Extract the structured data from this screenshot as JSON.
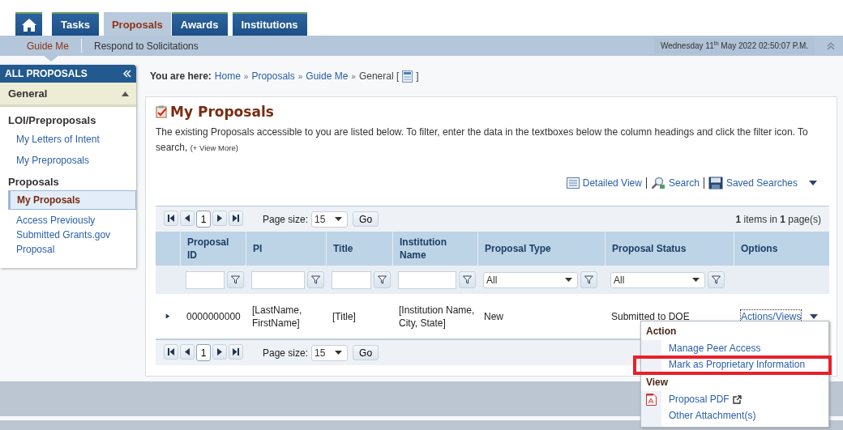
{
  "tabs": [
    {
      "kind": "home",
      "selected": false
    },
    {
      "kind": "text",
      "label": "Tasks",
      "selected": false
    },
    {
      "kind": "text",
      "label": "Proposals",
      "selected": true
    },
    {
      "kind": "text",
      "label": "Awards",
      "selected": false
    },
    {
      "kind": "text",
      "label": "Institutions",
      "selected": false
    }
  ],
  "subnav": [
    {
      "label": "Guide Me",
      "selected": true
    },
    {
      "label": "Respond to Solicitations",
      "selected": false
    }
  ],
  "datetime": "Wednesday 11$^{th}$ May 2022 02:50:07 P.M.",
  "sidebar": {
    "title": "ALL PROPOSALS",
    "sections": [
      {
        "label": "General",
        "expanded": true,
        "groups": [
          {
            "heading": "LOI/Preproposals",
            "items": [
              {
                "label": "My Letters of Intent",
                "selected": false
              },
              {
                "label": "My Preproposals",
                "selected": false
              }
            ]
          },
          {
            "heading": "Proposals",
            "items": [
              {
                "label": "My Proposals",
                "selected": true
              },
              {
                "label": "Access Previously Submitted Grants.gov Proposal",
                "selected": false
              }
            ]
          }
        ]
      }
    ]
  },
  "breadcrumb": {
    "prefix": "You are here:",
    "links": [
      "Home",
      "Proposals",
      "Guide Me"
    ],
    "separator": "»",
    "current": "General [",
    "suffix": "]"
  },
  "panel": {
    "title": "My Proposals",
    "description": "The existing Proposals accessible to you are listed below. To filter, enter the data in the textboxes below the column headings and click the filter icon. To search,",
    "more_link": "(+ View More)",
    "toolbar": [
      {
        "kind": "list",
        "label": "Detailed View"
      },
      {
        "kind": "search",
        "label": "Search"
      },
      {
        "kind": "save",
        "label": "Saved Searches"
      }
    ]
  },
  "grid": {
    "pagers": [
      {
        "page": "1",
        "page_size_label": "Page size:",
        "page_size": "15",
        "go": "Go",
        "summary": "**1** items in **1** page(s)"
      },
      {
        "page": "1",
        "page_size_label": "Page size:",
        "page_size": "15",
        "go": "Go"
      }
    ],
    "columns": [
      {
        "label": "Proposal ID",
        "filter": {
          "kind": "text"
        }
      },
      {
        "label": "PI",
        "filter": {
          "kind": "text"
        }
      },
      {
        "label": "Title",
        "filter": {
          "kind": "text"
        }
      },
      {
        "label": "Institution Name",
        "filter": {
          "kind": "text"
        }
      },
      {
        "label": "Proposal Type",
        "filter": {
          "kind": "select",
          "value": "All"
        }
      },
      {
        "label": "Proposal Status",
        "filter": {
          "kind": "select",
          "value": "All"
        }
      },
      {
        "label": "Options"
      }
    ],
    "rows": [
      {
        "expanded": false,
        "cells": [
          "0000000000",
          "[LastName, FirstName]",
          "[Title]",
          "[Institution Name, City, State]",
          "New",
          "Submitted to DOE"
        ],
        "options": "Actions/Views"
      }
    ]
  },
  "menu": {
    "sections": [
      {
        "heading": "Action",
        "items": [
          {
            "kind": "plain",
            "label": "Manage Peer Access",
            "highlighted": false
          },
          {
            "kind": "plain",
            "label": "Mark as Proprietary Information",
            "highlighted": true
          }
        ]
      },
      {
        "heading": "View",
        "items": [
          {
            "kind": "pdf",
            "label": "Proposal PDF",
            "highlighted": false
          },
          {
            "kind": "plain",
            "label": "Other Attachment(s)",
            "highlighted": false
          }
        ]
      }
    ]
  }
}
